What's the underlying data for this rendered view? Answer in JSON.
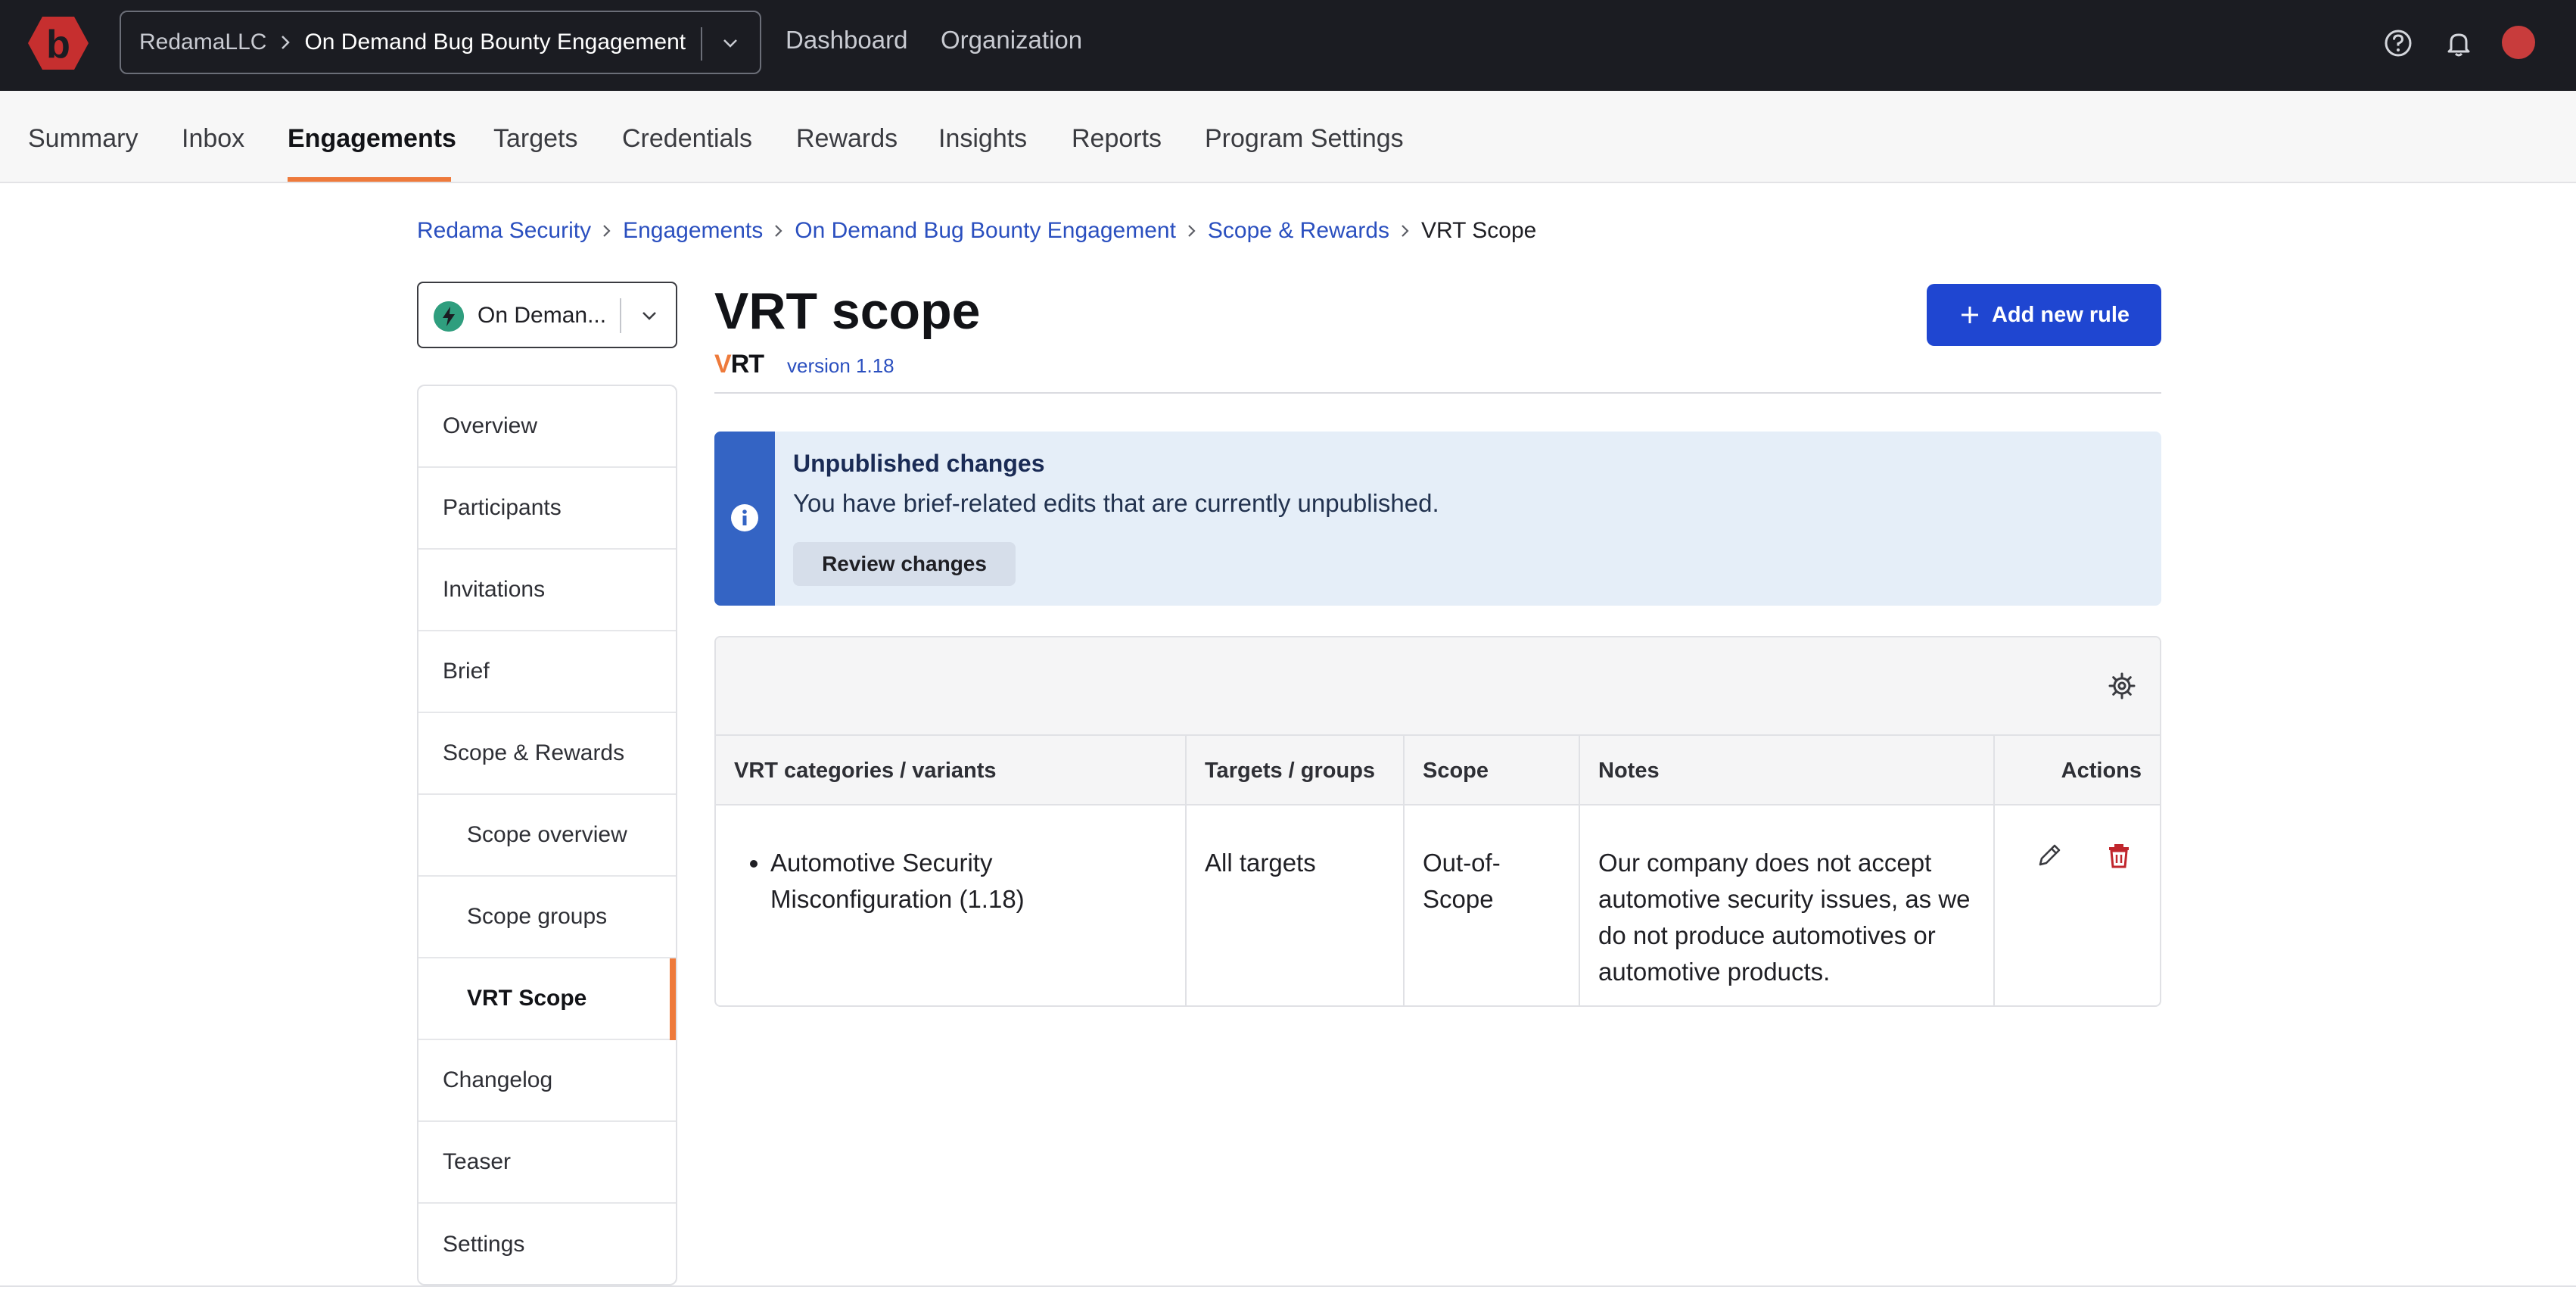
{
  "topbar": {
    "org_name": "RedamaLLC",
    "engagement_name": "On Demand Bug Bounty Engagement",
    "nav": [
      "Dashboard",
      "Organization"
    ],
    "brand_color": "#c62f2f"
  },
  "subnav": {
    "items": [
      "Summary",
      "Inbox",
      "Engagements",
      "Targets",
      "Credentials",
      "Rewards",
      "Insights",
      "Reports",
      "Program Settings"
    ],
    "active": "Engagements",
    "accent": "#ee7a3b"
  },
  "breadcrumb": {
    "links": [
      "Redama Security",
      "Engagements",
      "On Demand Bug Bounty Engagement",
      "Scope & Rewards"
    ],
    "current": "VRT Scope"
  },
  "engagement_select": {
    "label": "On Deman..."
  },
  "sidenav": {
    "items": [
      "Overview",
      "Participants",
      "Invitations",
      "Brief",
      "Scope & Rewards",
      "Scope overview",
      "Scope groups",
      "VRT Scope",
      "Changelog",
      "Teaser",
      "Settings"
    ],
    "active": "VRT Scope"
  },
  "main": {
    "title": "VRT scope",
    "vrt_logo_v": "V",
    "vrt_logo_rest": "RT",
    "version": "version 1.18",
    "add_button": "Add new rule",
    "primary_color": "#1f46d1"
  },
  "notice": {
    "title": "Unpublished changes",
    "text": "You have brief-related edits that are currently unpublished.",
    "button": "Review changes"
  },
  "table": {
    "columns": [
      "VRT categories / variants",
      "Targets / groups",
      "Scope",
      "Notes",
      "Actions"
    ],
    "rows": [
      {
        "category": "Automotive Security Misconfiguration (1.18)",
        "targets": "All targets",
        "scope": "Out-of-Scope",
        "notes": "Our company does not accept automotive security issues, as we do not produce automotives or automotive products."
      }
    ],
    "delete_color": "#c0262d"
  }
}
